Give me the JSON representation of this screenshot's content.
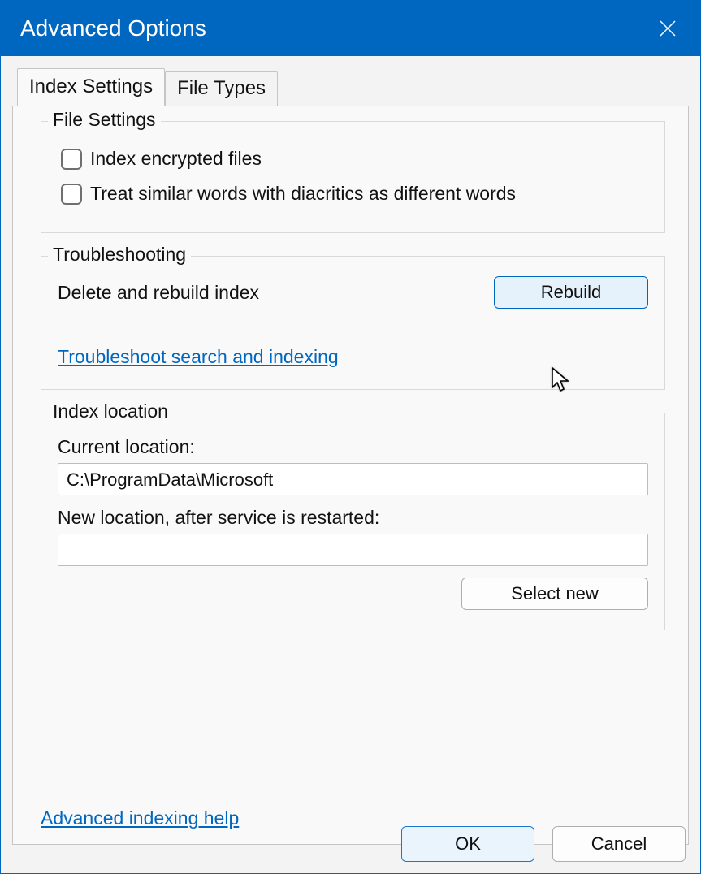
{
  "window": {
    "title": "Advanced Options"
  },
  "tabs": {
    "index_settings": "Index Settings",
    "file_types": "File Types"
  },
  "file_settings": {
    "legend": "File Settings",
    "encrypted_label": "Index encrypted files",
    "diacritics_label": "Treat similar words with diacritics as different words"
  },
  "troubleshooting": {
    "legend": "Troubleshooting",
    "rebuild_label": "Delete and rebuild index",
    "rebuild_button": "Rebuild",
    "troubleshoot_link": "Troubleshoot search and indexing"
  },
  "index_location": {
    "legend": "Index location",
    "current_label": "Current location:",
    "current_value": "C:\\ProgramData\\Microsoft",
    "new_label": "New location, after service is restarted:",
    "new_value": "",
    "select_new_button": "Select new"
  },
  "footer": {
    "help_link": "Advanced indexing help",
    "ok": "OK",
    "cancel": "Cancel"
  }
}
